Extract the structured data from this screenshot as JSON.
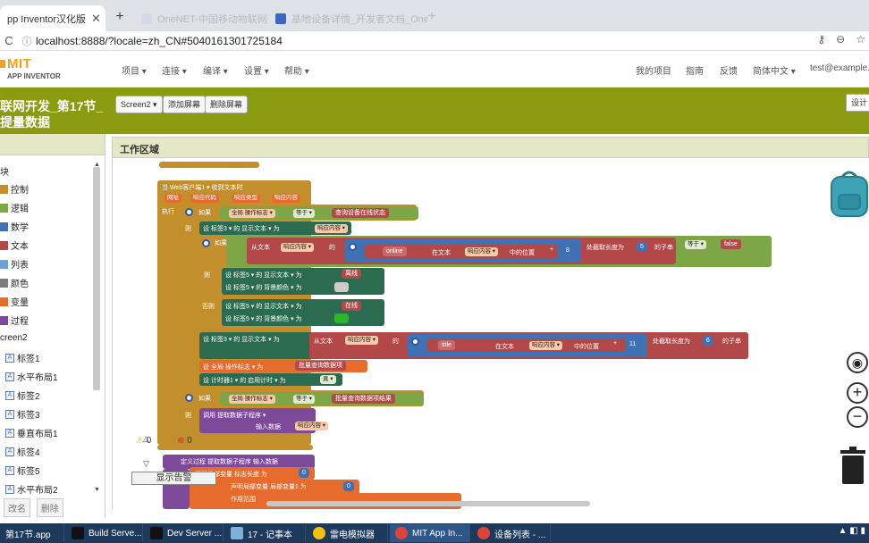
{
  "browser": {
    "tabs": [
      {
        "title": "pp Inventor汉化版",
        "active": true
      },
      {
        "title": "OneNET-中国移动物联网开放平台",
        "active": false
      },
      {
        "title": "基地设备详情_开发者文档_OneN",
        "active": false
      }
    ],
    "url": "localhost:8888/?locale=zh_CN#5040161301725184"
  },
  "header": {
    "logo_top": "MIT",
    "logo_bottom": "APP INVENTOR",
    "menus": [
      "项目 ▾",
      "连接 ▾",
      "编译 ▾",
      "设置 ▾",
      "帮助 ▾"
    ],
    "right_menus": [
      "我的项目",
      "指南",
      "反馈",
      "简体中文 ▾",
      "test@example.c"
    ]
  },
  "project": {
    "title": "联网开发_第17节_提量数据",
    "screen_button": "Screen2 ▾",
    "add_screen": "添加屏幕",
    "remove_screen": "删除屏幕",
    "design_button": "设计"
  },
  "palette": {
    "header": "",
    "section": "块",
    "builtins": [
      {
        "label": "控制",
        "color": "#c28f2c"
      },
      {
        "label": "逻辑",
        "color": "#7da646"
      },
      {
        "label": "数学",
        "color": "#3f71b5"
      },
      {
        "label": "文本",
        "color": "#b34848"
      },
      {
        "label": "列表",
        "color": "#6fa2d5"
      },
      {
        "label": "颜色",
        "color": "#7d7d7d"
      },
      {
        "label": "变量",
        "color": "#e66b2d"
      },
      {
        "label": "过程",
        "color": "#7d4a9a"
      }
    ],
    "screen": "creen2",
    "components": [
      "标签1",
      "水平布局1",
      "标签2",
      "标签3",
      "垂直布局1",
      "标签4",
      "标签5",
      "水平布局2"
    ],
    "rename": "改名",
    "delete": "删除"
  },
  "workspace": {
    "title": "工作区域",
    "event_block": "当 Web客户端1 ▾ 收到文本时",
    "event_params": [
      "网址",
      "响应代码",
      "响应类型",
      "响应内容"
    ],
    "execute": "执行",
    "if": "如果",
    "then": "则",
    "else": "否则",
    "global_op_flag": "全局 操作标志 ▾",
    "equals": "等于 ▾",
    "query_status": "查询设备在线状态",
    "set_label3_text": "设 标签3 ▾ 的 显示文本 ▾ 为",
    "response_content": "响应内容 ▾",
    "from_text": "从文本",
    "of": "的",
    "online": "online",
    "in_text": "在文本",
    "position_in": "中的位置",
    "plus": "+",
    "n8": "8",
    "take_length": "处截取长度为",
    "n5": "5",
    "substring": "的子串",
    "false_text": "false",
    "set_label5_text_offline": "离线",
    "set_label5_bg": "背景颜色",
    "online_cn": "在线",
    "title_text": "title",
    "n11": "11",
    "n6": "6",
    "set_global_op": "设 全局 操作标志 ▾ 为",
    "batch_query": "批量查询数据项",
    "set_timer": "设 计时器1 ▾ 的 启用计时 ▾ 为",
    "true_text": "真 ▾",
    "batch_query_result": "批量查询数据项结果",
    "call_proc": "调用 提取数据子程序 ▾",
    "input_data": "输入数据",
    "define_proc": "定义过程 提取数据子程序 输入数据",
    "local_var_len": "声明局部变量 标志长度 为",
    "n0": "0",
    "local_var_1": "声明局部变量 局部变量1 为",
    "scope": "作用范围",
    "warnings_count": "0",
    "errors_count": "0",
    "show_warnings": "显示告警"
  },
  "taskbar": {
    "items": [
      "第17节.app",
      "Build Serve...",
      "Dev Server ...",
      "17 - 记事本",
      "雷电模拟器",
      "MIT App In...",
      "设备列表 - ..."
    ]
  },
  "colors": {
    "control": "#c28f2c",
    "logic": "#7da646",
    "math": "#3f71b5",
    "text": "#b34848",
    "variable": "#e66b2d",
    "component": "#2b6b4f",
    "procedure": "#7d4a9a",
    "project_bar": "#8a9b0f"
  }
}
